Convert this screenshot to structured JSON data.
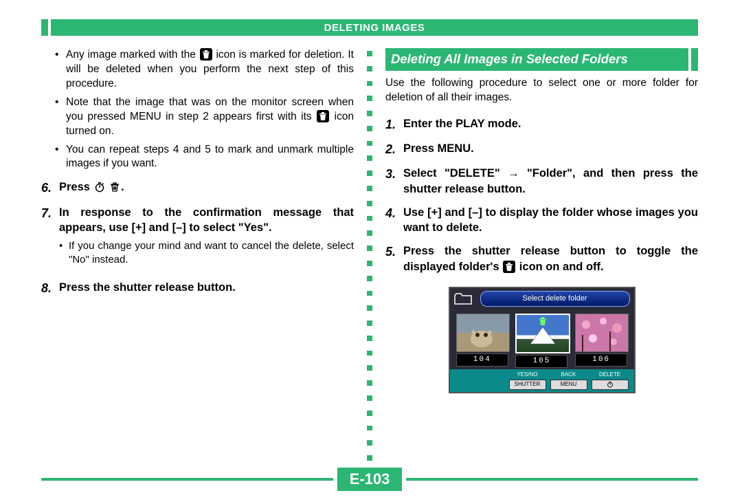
{
  "header": {
    "title": "DELETING IMAGES"
  },
  "page_number": "E-103",
  "left": {
    "bullets": [
      "Any image marked with the [trash] icon is marked for deletion. It will be deleted when you perform the next step of this procedure.",
      "Note that the image that was on the monitor screen when you pressed MENU in step 2 appears first with its [trash] icon turned on.",
      "You can repeat steps 4 and 5 to mark and unmark multiple images if you want."
    ],
    "step6": {
      "num": "6.",
      "text_prefix": "Press ",
      "text_suffix": "."
    },
    "step7": {
      "num": "7.",
      "text": "In response to the confirmation message that appears, use [+] and [–] to select \"Yes\"."
    },
    "step7_sub": "If you change your mind and want to cancel the delete, select \"No\" instead.",
    "step8": {
      "num": "8.",
      "text": "Press the shutter release button."
    }
  },
  "right": {
    "heading": "Deleting All Images in Selected Folders",
    "intro": "Use the following procedure to select one or more folder for deletion of all their images.",
    "step1": {
      "num": "1.",
      "text": "Enter the PLAY mode."
    },
    "step2": {
      "num": "2.",
      "text": "Press MENU."
    },
    "step3": {
      "num": "3.",
      "text": "Select \"DELETE\" → \"Folder\", and then press the shutter release button."
    },
    "step4": {
      "num": "4.",
      "text": "Use [+] and [–] to display the folder whose images you want to delete."
    },
    "step5": {
      "num": "5.",
      "text_prefix": "Press the shutter release button to toggle the displayed folder's ",
      "text_suffix": " icon on and off."
    }
  },
  "lcd": {
    "title": "Select delete folder",
    "thumbs": [
      "104",
      "105",
      "106"
    ],
    "buttons": {
      "yesno": "YES/NO",
      "shutter": "SHUTTER",
      "back": "BACK",
      "menu": "MENU",
      "delete": "DELETE"
    }
  }
}
